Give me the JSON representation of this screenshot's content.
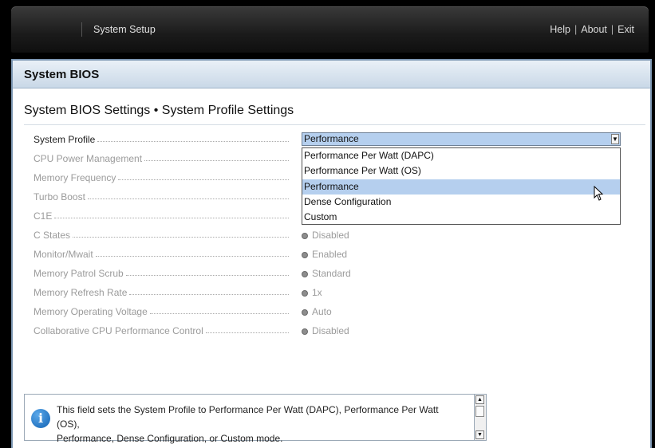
{
  "header": {
    "title": "System Setup",
    "links": {
      "help": "Help",
      "about": "About",
      "exit": "Exit",
      "separator": "|"
    }
  },
  "panel": {
    "heading": "System BIOS",
    "section_title": "System BIOS Settings • System Profile Settings"
  },
  "settings": [
    {
      "label": "System Profile",
      "value": "Performance",
      "enabled": true
    },
    {
      "label": "CPU Power Management",
      "value": "",
      "enabled": false
    },
    {
      "label": "Memory Frequency",
      "value": "",
      "enabled": false
    },
    {
      "label": "Turbo Boost",
      "value": "",
      "enabled": false
    },
    {
      "label": "C1E",
      "value": "",
      "enabled": false
    },
    {
      "label": "C States",
      "value": "Disabled",
      "enabled": false
    },
    {
      "label": "Monitor/Mwait",
      "value": "Enabled",
      "enabled": false
    },
    {
      "label": "Memory Patrol Scrub",
      "value": "Standard",
      "enabled": false
    },
    {
      "label": "Memory Refresh Rate",
      "value": "1x",
      "enabled": false
    },
    {
      "label": "Memory Operating Voltage",
      "value": "Auto",
      "enabled": false
    },
    {
      "label": "Collaborative CPU Performance Control",
      "value": "Disabled",
      "enabled": false
    }
  ],
  "dropdown": {
    "options": [
      "Performance Per Watt (DAPC)",
      "Performance Per Watt (OS)",
      "Performance",
      "Dense Configuration",
      "Custom"
    ],
    "highlighted": "Performance"
  },
  "help_text": {
    "line1": "This field sets the System Profile to Performance Per Watt (DAPC), Performance Per Watt (OS),",
    "line2": "Performance, Dense Configuration, or Custom mode."
  },
  "icons": {
    "info": "info-icon",
    "radio": "radio-icon",
    "dropdown_arrow": "chevron-down-icon",
    "scroll_up": "scroll-up-icon",
    "scroll_down": "scroll-down-icon",
    "cursor": "mouse-cursor-icon"
  },
  "colors": {
    "selection": "#b5cfee",
    "panel_border": "#7d97b3",
    "info_blue": "#1262b3"
  }
}
